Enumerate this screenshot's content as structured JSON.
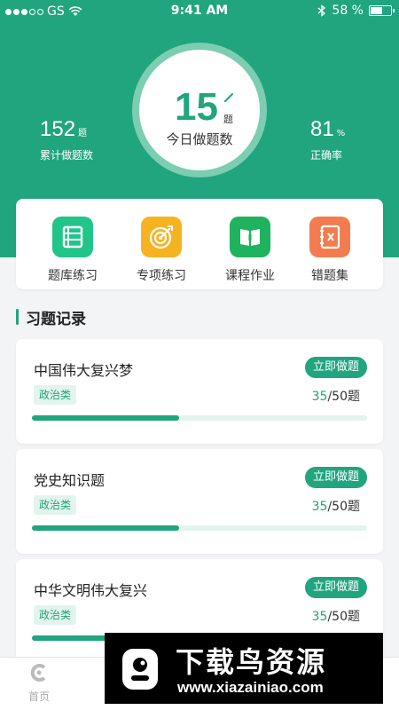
{
  "status_bar": {
    "carrier": "GS",
    "time": "9:41 AM",
    "battery": "58 %",
    "battery_level": 0.58
  },
  "summary": {
    "today_count": "15",
    "today_unit": "题",
    "today_label": "今日做题数",
    "total_count": "152",
    "total_unit": "题",
    "total_label": "累计做题数",
    "accuracy": "81",
    "accuracy_unit": "%",
    "accuracy_label": "正确率"
  },
  "quick_actions": [
    {
      "label": "题库练习",
      "icon": "question-bank-icon",
      "color": "#21c58a"
    },
    {
      "label": "专项练习",
      "icon": "target-icon",
      "color": "#f6b321"
    },
    {
      "label": "课程作业",
      "icon": "book-icon",
      "color": "#1fb25f"
    },
    {
      "label": "错题集",
      "icon": "wrong-notebook-icon",
      "color": "#f27c4f"
    }
  ],
  "section": {
    "title": "习题记录"
  },
  "records": [
    {
      "title": "中国伟大复兴梦",
      "tag": "政治类",
      "button": "立即做题",
      "done": "35",
      "total": "/50题",
      "progress": 0.44
    },
    {
      "title": "党史知识题",
      "tag": "政治类",
      "button": "立即做题",
      "done": "35",
      "total": "/50题",
      "progress": 0.44
    },
    {
      "title": "中华文明伟大复兴",
      "tag": "政治类",
      "button": "立即做题",
      "done": "35",
      "total": "/50题",
      "progress": 0.44
    }
  ],
  "tab_bar": {
    "home_label": "首页",
    "home_icon": "home-c-icon"
  },
  "watermark": {
    "title": "下载鸟资源",
    "url": "www.xiazainiao.com"
  },
  "colors": {
    "primary": "#21a57e",
    "primary_light": "#e2f4ed",
    "ring": "#7ccdb2"
  }
}
